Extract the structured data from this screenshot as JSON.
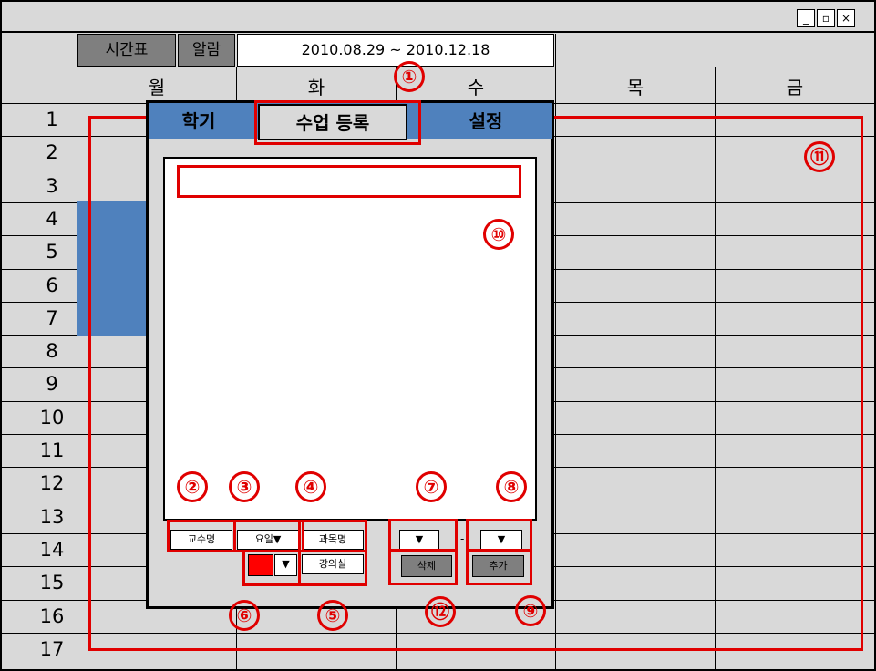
{
  "window": {
    "controls": {
      "minimize": "_",
      "restore": "▫",
      "close": "×"
    }
  },
  "top_tabs": {
    "timetable": "시간표",
    "alarm": "알람",
    "date_range": "2010.08.29 ~ 2010.12.18"
  },
  "days": [
    "월",
    "화",
    "수",
    "목",
    "금"
  ],
  "rows": [
    "1",
    "2",
    "3",
    "4",
    "5",
    "6",
    "7",
    "8",
    "9",
    "10",
    "11",
    "12",
    "13",
    "14",
    "15",
    "16",
    "17"
  ],
  "dialog": {
    "tabs": {
      "semester": "학기",
      "course_register": "수업 등록",
      "settings": "설정"
    },
    "fields": {
      "professor": "교수명",
      "day": "요일▼",
      "course": "과목명",
      "room": "강의실",
      "dropdown_arrow": "▼",
      "dash": "-"
    },
    "buttons": {
      "delete": "삭제",
      "add": "추가"
    }
  },
  "annotations": [
    "①",
    "②",
    "③",
    "④",
    "⑤",
    "⑥",
    "⑦",
    "⑧",
    "⑨",
    "⑩",
    "⑪",
    "⑫"
  ],
  "colors": {
    "accent_blue": "#4f81bd",
    "annotation_red": "#e00000",
    "swatch": "#ff0000"
  }
}
